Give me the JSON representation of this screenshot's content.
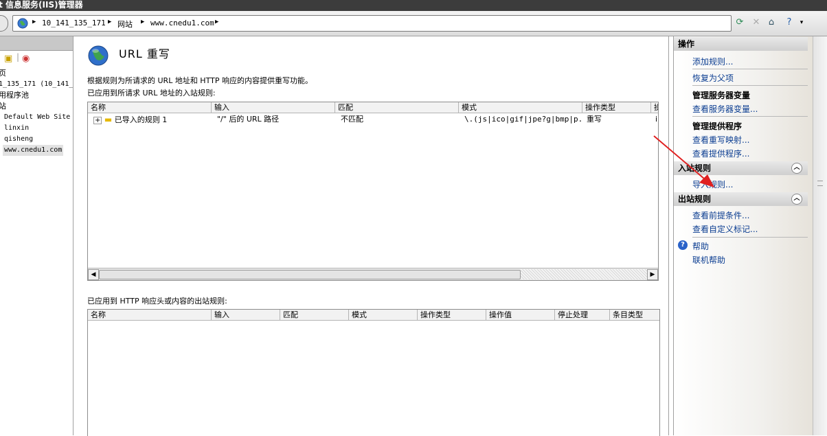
{
  "window": {
    "title": "et 信息服务(IIS)管理器"
  },
  "address": {
    "crumbs": [
      "10_141_135_171",
      "网站",
      "www.cnedu1.com"
    ]
  },
  "left_tree": {
    "items": [
      "页",
      "1_135_171 (10_141_",
      "用程序池",
      "站",
      "Default Web Site",
      "linxin",
      "qisheng",
      "www.cnedu1.com"
    ]
  },
  "main": {
    "title": "URL 重写",
    "description": "根据规则为所请求的 URL 地址和 HTTP 响应的内容提供重写功能。",
    "inbound_label": "已应用到所请求 URL 地址的入站规则:",
    "inbound_columns": [
      "名称",
      "输入",
      "匹配",
      "模式",
      "操作类型",
      "操"
    ],
    "inbound_rows": [
      {
        "name": "已导入的规则 1",
        "input": "\"/\" 后的 URL 路径",
        "match": "不匹配",
        "pattern": "\\.(js|ico|gif|jpe?g|bmp|p...",
        "action": "重写",
        "extra": "i"
      }
    ],
    "outbound_label": "已应用到 HTTP 响应头或内容的出站规则:",
    "outbound_columns": [
      "名称",
      "输入",
      "匹配",
      "模式",
      "操作类型",
      "操作值",
      "停止处理",
      "条目类型"
    ]
  },
  "actions": {
    "header": "操作",
    "add_rule": "添加规则...",
    "revert": "恢复为父项",
    "server_vars_title": "管理服务器变量",
    "view_server_vars": "查看服务器变量...",
    "providers_title": "管理提供程序",
    "view_rewrite_maps": "查看重写映射...",
    "view_providers": "查看提供程序...",
    "inbound_header": "入站规则",
    "import_rules": "导入规则...",
    "outbound_header": "出站规则",
    "view_preconditions": "查看前提条件...",
    "view_custom_tags": "查看自定义标记...",
    "help": "帮助",
    "online_help": "联机帮助"
  },
  "colors": {
    "titlebar": "#3c3c3c",
    "link": "#0b3d91",
    "annotation_arrow": "#e02020"
  }
}
